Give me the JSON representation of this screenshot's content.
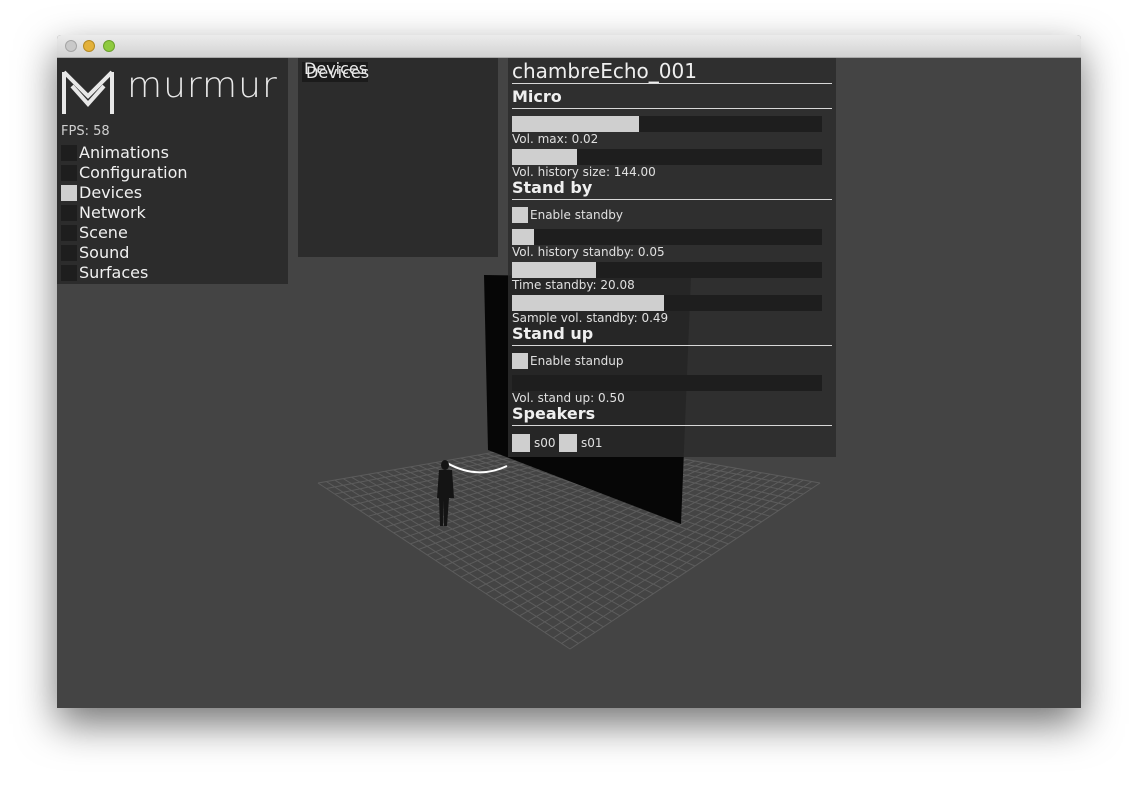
{
  "app": {
    "logo_text": "murmur",
    "fps_label": "FPS: 58"
  },
  "menu": {
    "items": [
      {
        "label": "Animations",
        "active": false
      },
      {
        "label": "Configuration",
        "active": false
      },
      {
        "label": "Devices",
        "active": true
      },
      {
        "label": "Network",
        "active": false
      },
      {
        "label": "Scene",
        "active": false
      },
      {
        "label": "Sound",
        "active": false
      },
      {
        "label": "Surfaces",
        "active": false
      }
    ]
  },
  "devices_panel": {
    "title": "Devices"
  },
  "device": {
    "name": "chambreEcho_001",
    "micro": {
      "header": "Micro",
      "vol_max": {
        "label": "Vol. max: 0.02",
        "level": 0.41
      },
      "vol_history_size": {
        "label": "Vol. history size: 144.00",
        "level": 0.21
      }
    },
    "standby": {
      "header": "Stand by",
      "enable_label": "Enable standby",
      "vol_history_standby": {
        "label": "Vol. history standby: 0.05",
        "level": 0.07
      },
      "time_standby": {
        "label": "Time standby: 20.08",
        "level": 0.27
      },
      "sample_vol_standby": {
        "label": "Sample vol. standby: 0.49",
        "level": 0.49
      }
    },
    "standup": {
      "header": "Stand up",
      "enable_label": "Enable standup",
      "vol_stand_up": {
        "label": "Vol. stand up: 0.50",
        "level": 0.0
      }
    },
    "speakers": {
      "header": "Speakers",
      "items": [
        "s00",
        "s01"
      ]
    }
  },
  "colors": {
    "background": "#444444",
    "panel": "#2c2c2c",
    "slider_track": "#1e1e1e",
    "slider_fill": "#cfcfcf",
    "text": "#e8e8e8"
  }
}
